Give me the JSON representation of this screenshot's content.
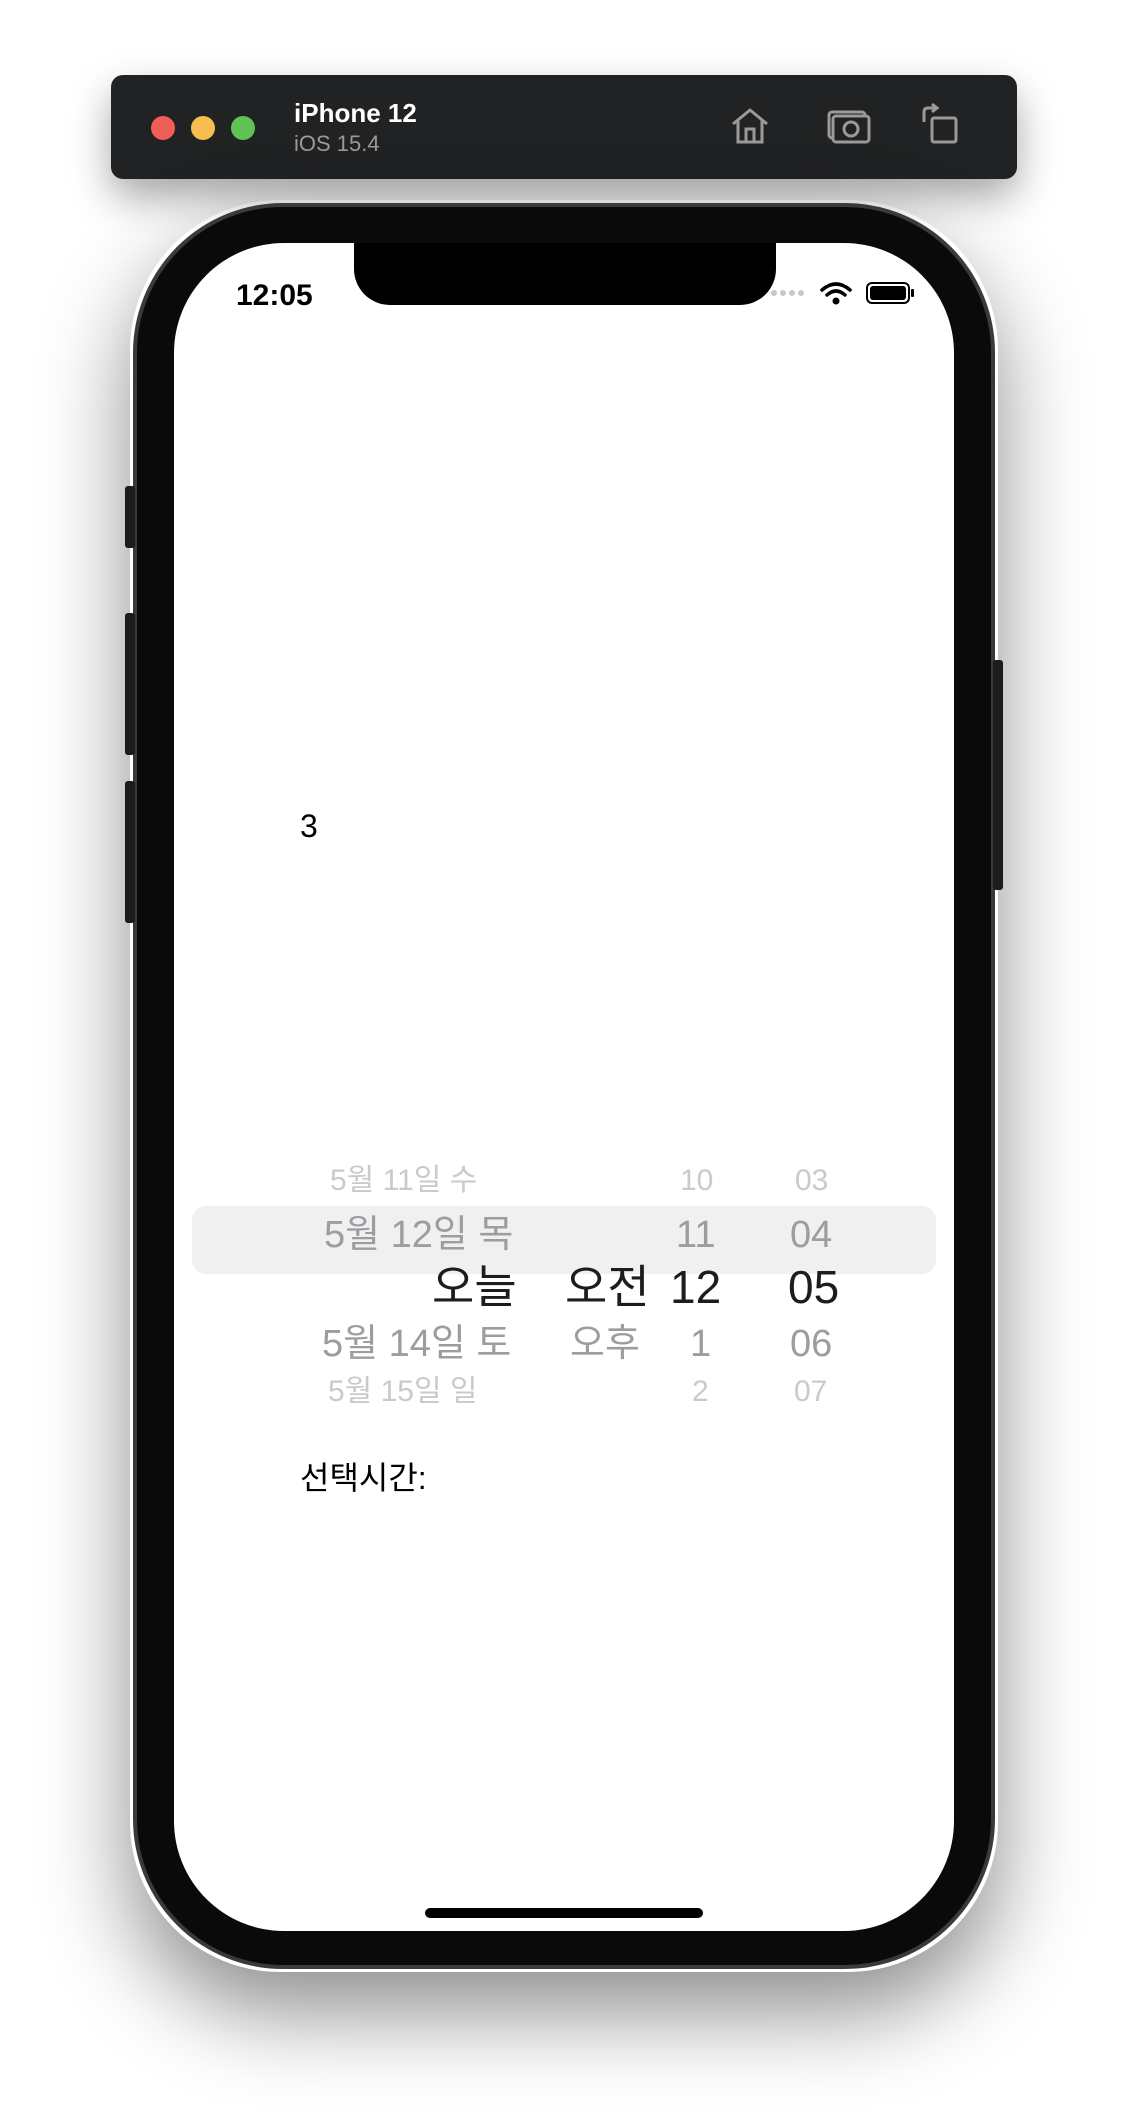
{
  "titlebar": {
    "device_name": "iPhone 12",
    "os_version": "iOS 15.4",
    "buttons": {
      "home": "home-icon",
      "screenshot": "camera-icon",
      "rotate": "rotate-icon"
    }
  },
  "status_bar": {
    "time": "12:05"
  },
  "content": {
    "count_label": "3",
    "selected_time_label": "선택시간:"
  },
  "picker": {
    "date_column": [
      "5월 11일 수",
      "5월 12일 목",
      "오늘",
      "5월 14일 토",
      "5월 15일 일"
    ],
    "ampm_column": [
      "",
      "",
      "오전",
      "오후",
      ""
    ],
    "hour_column": [
      "10",
      "11",
      "12",
      "1",
      "2"
    ],
    "minute_column": [
      "03",
      "04",
      "05",
      "06",
      "07"
    ],
    "selected": {
      "date": "오늘",
      "ampm": "오전",
      "hour": "12",
      "minute": "05"
    }
  },
  "colors": {
    "close": "#ed5f57",
    "minimize": "#f5be4f",
    "zoom": "#5fc453",
    "titlebar": "#212223",
    "picker_highlight": "#f0f0f1"
  }
}
